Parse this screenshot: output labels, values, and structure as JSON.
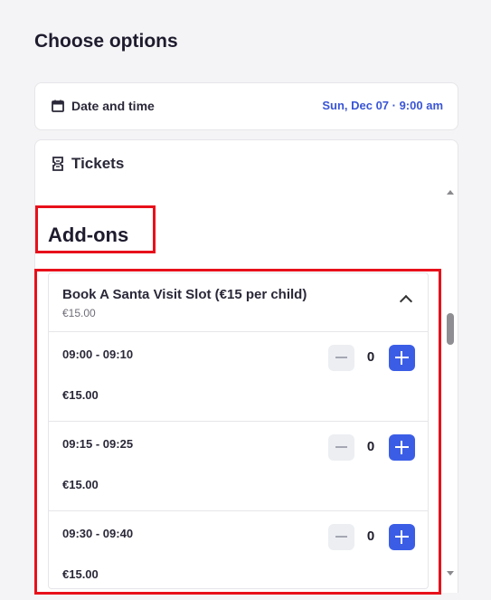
{
  "page": {
    "title": "Choose options"
  },
  "date_time": {
    "label": "Date and time",
    "value": "Sun, Dec 07 · 9:00 am",
    "icon": "calendar-icon"
  },
  "tickets": {
    "label": "Tickets",
    "icon": "ticket-icon"
  },
  "addons": {
    "title": "Add-ons",
    "item": {
      "name": "Book A Santa Visit Slot (€15 per child)",
      "price": "€15.00",
      "slots": [
        {
          "time": "09:00 - 09:10",
          "price": "€15.00",
          "qty": "0"
        },
        {
          "time": "09:15 - 09:25",
          "price": "€15.00",
          "qty": "0"
        },
        {
          "time": "09:30 - 09:40",
          "price": "€15.00",
          "qty": "0"
        }
      ]
    }
  },
  "colors": {
    "accent": "#3b5de6",
    "date_value": "#3a55d6",
    "highlight": "#e8101a"
  }
}
